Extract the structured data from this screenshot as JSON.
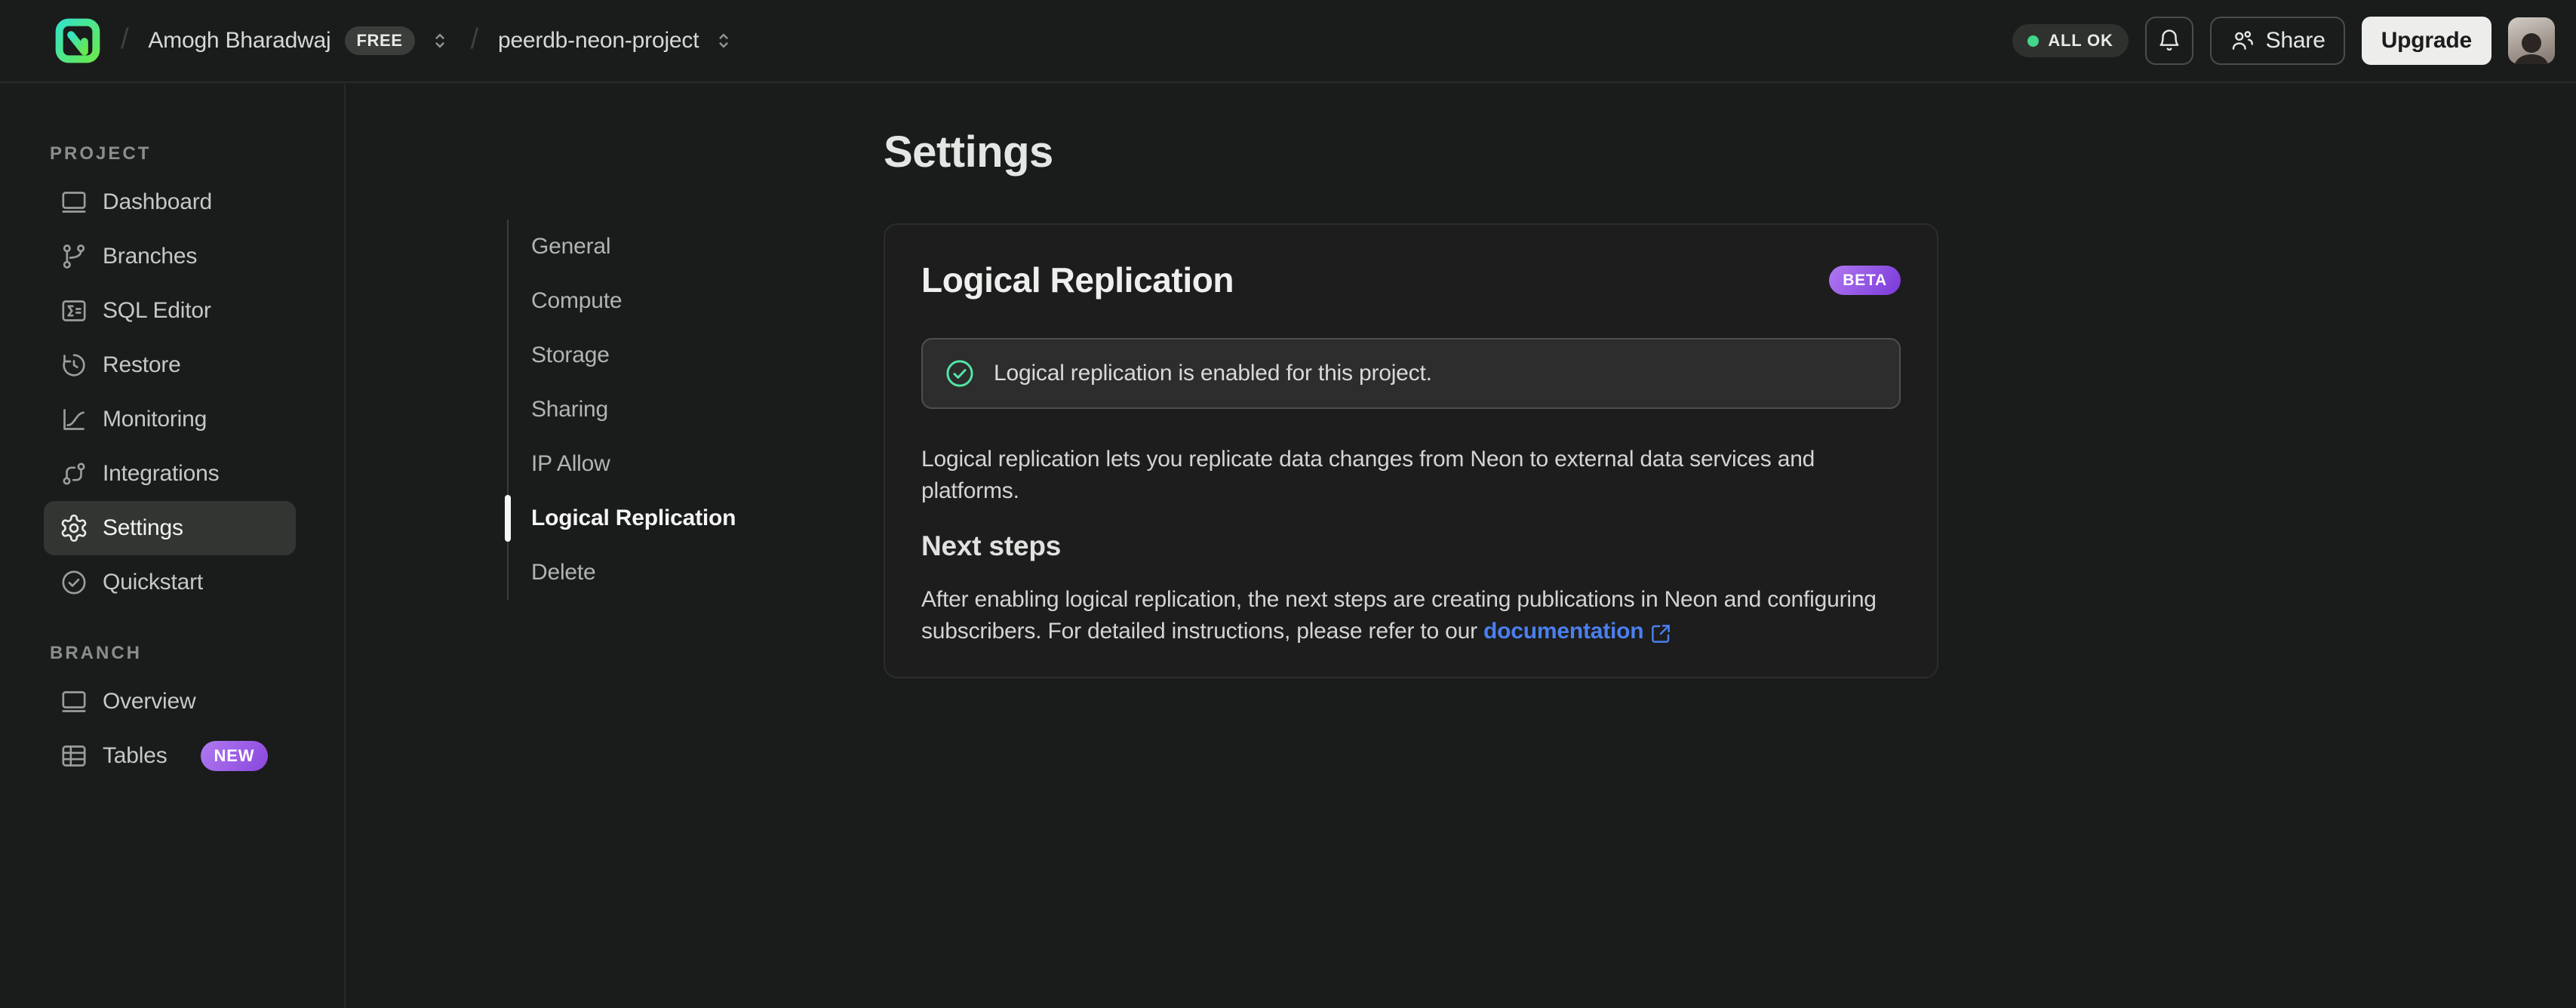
{
  "topbar": {
    "org_name": "Amogh Bharadwaj",
    "plan_badge": "FREE",
    "project_name": "peerdb-neon-project",
    "status_label": "ALL OK",
    "share_label": "Share",
    "upgrade_label": "Upgrade"
  },
  "sidebar": {
    "sections": [
      {
        "label": "PROJECT",
        "items": [
          {
            "label": "Dashboard"
          },
          {
            "label": "Branches"
          },
          {
            "label": "SQL Editor"
          },
          {
            "label": "Restore"
          },
          {
            "label": "Monitoring"
          },
          {
            "label": "Integrations"
          },
          {
            "label": "Settings",
            "active": true
          },
          {
            "label": "Quickstart"
          }
        ]
      },
      {
        "label": "BRANCH",
        "items": [
          {
            "label": "Overview"
          },
          {
            "label": "Tables",
            "badge": "NEW"
          }
        ]
      }
    ]
  },
  "subnav": {
    "items": [
      {
        "label": "General"
      },
      {
        "label": "Compute"
      },
      {
        "label": "Storage"
      },
      {
        "label": "Sharing"
      },
      {
        "label": "IP Allow"
      },
      {
        "label": "Logical Replication",
        "active": true
      },
      {
        "label": "Delete"
      }
    ]
  },
  "main": {
    "page_title": "Settings",
    "card": {
      "title": "Logical Replication",
      "beta_badge": "BETA",
      "alert_text": "Logical replication is enabled for this project.",
      "description": "Logical replication lets you replicate data changes from Neon to external data services and platforms.",
      "next_steps_title": "Next steps",
      "next_steps_text": "After enabling logical replication, the next steps are creating publications in Neon and configuring subscribers. For detailed instructions, please refer to our",
      "link_label": "documentation"
    }
  },
  "icons": {
    "logo": "neon-logo",
    "status_dot": "green-dot",
    "bell": "notifications",
    "users": "share-people",
    "check_circle": "success-check",
    "external_link": "open-in-new"
  },
  "colors": {
    "background": "#1a1b1b",
    "card_background": "#1c1d1c",
    "alert_background": "#2c2d2c",
    "success_green": "#53e5a6",
    "status_dot_green": "#42d68c",
    "badge_purple_start": "#b078f2",
    "badge_purple_end": "#7a39d8",
    "link_blue": "#4b7ff0",
    "upgrade_button": "#ededec",
    "logo_gradient_start": "#35e3c3",
    "logo_gradient_end": "#68e94f"
  }
}
